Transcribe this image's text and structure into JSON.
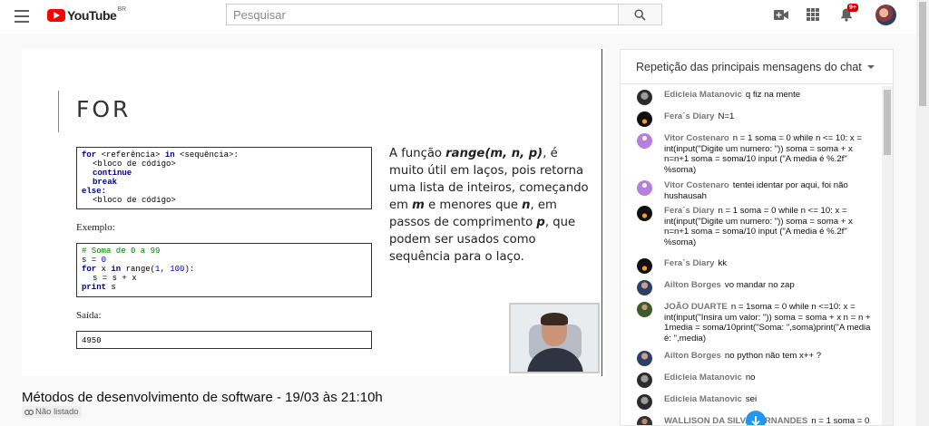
{
  "header": {
    "logo_text": "YouTube",
    "country_code": "BR",
    "search_placeholder": "Pesquisar",
    "notification_count": "9+"
  },
  "slide": {
    "title": "FOR",
    "syntax_lines": [
      {
        "parts": [
          [
            "kw",
            "for"
          ],
          [
            "",
            " <referência> "
          ],
          [
            "kw",
            "in"
          ],
          [
            "",
            " <sequência>:"
          ]
        ]
      },
      {
        "indent": true,
        "parts": [
          [
            "",
            "<bloco de código>"
          ]
        ]
      },
      {
        "indent": true,
        "parts": [
          [
            "kw",
            "continue"
          ]
        ]
      },
      {
        "indent": true,
        "parts": [
          [
            "kw",
            "break"
          ]
        ]
      },
      {
        "parts": [
          [
            "kw",
            "else:"
          ]
        ]
      },
      {
        "indent": true,
        "parts": [
          [
            "",
            "<bloco de código>"
          ]
        ]
      }
    ],
    "example_label": "Exemplo:",
    "example_lines": [
      {
        "parts": [
          [
            "cm",
            "# Soma de 0 a 99"
          ]
        ]
      },
      {
        "parts": [
          [
            "",
            "s = "
          ],
          [
            "nm",
            "0"
          ]
        ]
      },
      {
        "parts": [
          [
            "kw",
            "for"
          ],
          [
            "",
            " x "
          ],
          [
            "kw",
            "in"
          ],
          [
            "",
            " range("
          ],
          [
            "nm",
            "1"
          ],
          [
            "",
            ", "
          ],
          [
            "nm",
            "100"
          ],
          [
            "",
            "):"
          ]
        ]
      },
      {
        "indent": true,
        "parts": [
          [
            "",
            "s = s + x"
          ]
        ]
      },
      {
        "parts": [
          [
            "kw",
            "print"
          ],
          [
            "",
            " s"
          ]
        ]
      }
    ],
    "output_label": "Saída:",
    "output_value": "4950",
    "text_before": "A função ",
    "text_func": "range(m, n, p)",
    "text_mid1": ", é muito útil em laços, pois retorna uma lista de inteiros, começando em ",
    "text_m": "m",
    "text_mid2": " e menores que ",
    "text_n": "n",
    "text_mid3": ", em passos de comprimento ",
    "text_p": "p",
    "text_end": ", que podem ser usados como sequência para o laço."
  },
  "video": {
    "title": "Métodos de desenvolvimento de software - 19/03 às 21:10h",
    "visibility": "Não listado"
  },
  "chat": {
    "header": "Repetição das principais mensagens do chat",
    "messages": [
      {
        "author": "Edicleia Matanovic",
        "text": "q fiz na mente",
        "avatar": "av-dark"
      },
      {
        "author": "Fera´s Diary",
        "text": "N=1",
        "avatar": "av-fera"
      },
      {
        "author": "Vitor Costenaro",
        "text": "n = 1 soma = 0 while n <= 10: x = int(input(\"Digite um numero: \")) soma = soma + x n=n+1 soma = soma/10 input (\"A media é %.2f\" %soma)",
        "avatar": "av-purple"
      },
      {
        "author": "Vitor Costenaro",
        "text": "tentei identar por aqui, foi não hushausah",
        "avatar": "av-purple"
      },
      {
        "author": "Fera´s Diary",
        "text": "n = 1 soma = 0 while n <= 10: x = int(input(\"Digite um numero: \")) soma = soma + x n=n+1 soma = soma/10 input (\"A media é %.2f\" %soma)",
        "avatar": "av-fera"
      },
      {
        "author": "Fera´s Diary",
        "text": "kk",
        "avatar": "av-fera"
      },
      {
        "author": "Ailton Borges",
        "text": "vo mandar no zap",
        "avatar": "av-ailton"
      },
      {
        "author": "JOÃO DUARTE",
        "text": "n = 1soma = 0 while n <=10: x = int(input(\"Insira um valor: \")) soma = soma + x n = n + 1media = soma/10print(\"Soma: \",soma)print(\"A media é: \",media)",
        "avatar": "av-joao"
      },
      {
        "author": "Ailton Borges",
        "text": "no python não tem x++ ?",
        "avatar": "av-ailton"
      },
      {
        "author": "Edicleia Matanovic",
        "text": "no",
        "avatar": "av-dark"
      },
      {
        "author": "Edicleia Matanovic",
        "text": "sei",
        "avatar": "av-dark"
      },
      {
        "author": "WALLISON DA SILVA FERNANDES",
        "text": "n = 1 soma = 0",
        "avatar": "av-wall"
      }
    ]
  }
}
